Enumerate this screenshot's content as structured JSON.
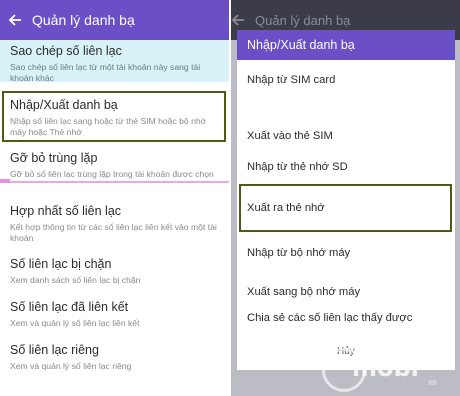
{
  "left": {
    "title": "Quản lý danh bạ",
    "items": [
      {
        "title": "Sao chép số liên lạc",
        "subtitle": "Sao chép số liên lạc từ một tài khoản này sang tài khoản khác"
      },
      {
        "title": "Nhập/Xuất danh bạ",
        "subtitle": "Nhập số liên lạc sang hoặc từ thẻ SIM hoặc bộ nhớ máy hoặc Thẻ nhớ"
      },
      {
        "title": "Gỡ bỏ trùng lặp",
        "subtitle": "Gỡ bỏ số liên lạc trùng lặp trong tài khoản được chọn"
      },
      {
        "title": "Hợp nhất số liên lạc",
        "subtitle": "Kết hợp thông tin từ các số liên lạc liên kết vào một tài khoản"
      },
      {
        "title": "Số liên lạc bị chặn",
        "subtitle": "Xem danh sách số liên lạc bị chặn"
      },
      {
        "title": "Số liên lạc đã liên kết",
        "subtitle": "Xem và quản lý số liên lạc liên kết"
      },
      {
        "title": "Số liên lạc riêng",
        "subtitle": "Xem và quản lý số liên lạc riêng"
      }
    ]
  },
  "right": {
    "title": "Quản lý danh bạ",
    "dialog": {
      "title": "Nhập/Xuất danh bạ",
      "options": [
        "Nhập từ SIM card",
        "Xuất vào thẻ SIM",
        "Nhập từ thẻ nhớ SD",
        "Xuất ra thẻ nhớ",
        "Nhập từ bộ nhớ máy",
        "Xuất sang bộ nhớ máy",
        "Chia sẻ các số liên lạc thấy được"
      ],
      "cancel": "Hủy"
    }
  },
  "watermark": {
    "text": "mobi",
    "suffix": ".vn"
  },
  "colors": {
    "accent": "#6a4fc6",
    "highlight_box": "#4f5a15",
    "highlight_bg": "#d9f2f7"
  }
}
